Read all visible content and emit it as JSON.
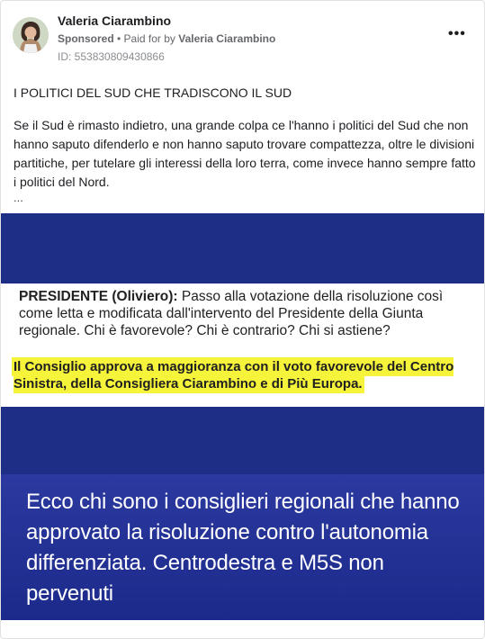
{
  "author": {
    "name": "Valeria Ciarambino",
    "sponsored": "Sponsored",
    "paid_for_prefix": "• Paid for by",
    "paid_for_name": "Valeria Ciarambino",
    "id": "ID: 553830809430866"
  },
  "menu_glyph": "•••",
  "post": {
    "headline": "I POLITICI DEL SUD CHE TRADISCONO IL SUD",
    "text": "Se il Sud è rimasto indietro, una grande colpa ce l'hanno i politici del Sud che non hanno saputo difenderlo e non hanno saputo trovare compattezza, oltre le divisioni partitiche, per tutelare gli interessi della loro terra, come invece hanno sempre fatto i politici del Nord.",
    "ellipsis": "..."
  },
  "image": {
    "speaker": "PRESIDENTE (Oliviero):",
    "statement": "Passo alla votazione della risoluzione così come letta e modificata dall'intervento del Presidente della Giunta regionale. Chi è favorevole? Chi è contrario? Chi si astiene?",
    "highlight": "Il Consiglio approva a maggioranza con il voto favorevole del Centro Sinistra, della Consigliera Ciarambino e di Più Europa.",
    "caption": "Ecco chi sono i consiglieri regionali che hanno approvato la risoluzione contro l'autonomia differenziata. Centrodestra e M5S non pervenuti"
  },
  "colors": {
    "image_background": "#1e2e86",
    "highlight": "#f6f43a"
  }
}
